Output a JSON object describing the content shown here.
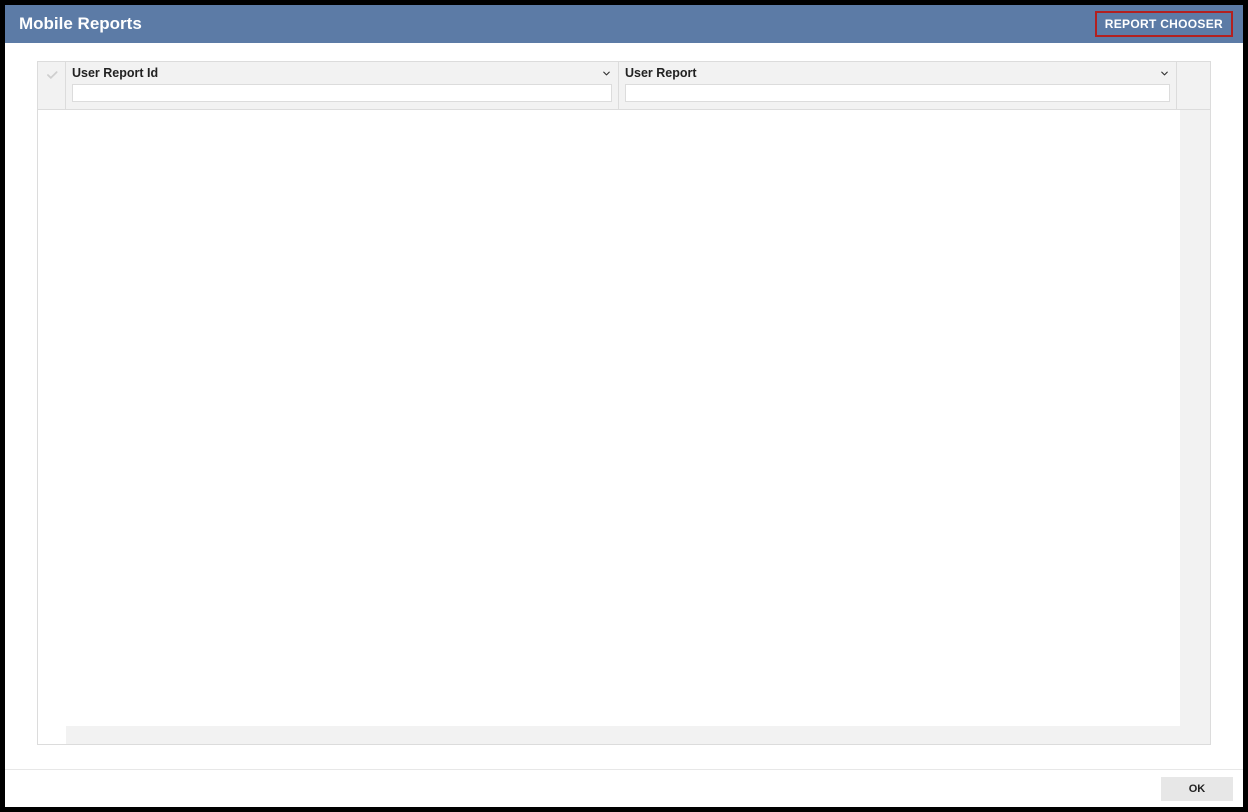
{
  "header": {
    "title": "Mobile Reports",
    "report_chooser_label": "REPORT CHOOSER"
  },
  "grid": {
    "columns": [
      {
        "label": "User Report Id",
        "filter_value": ""
      },
      {
        "label": "User Report",
        "filter_value": ""
      }
    ],
    "rows": []
  },
  "footer": {
    "ok_label": "OK"
  }
}
